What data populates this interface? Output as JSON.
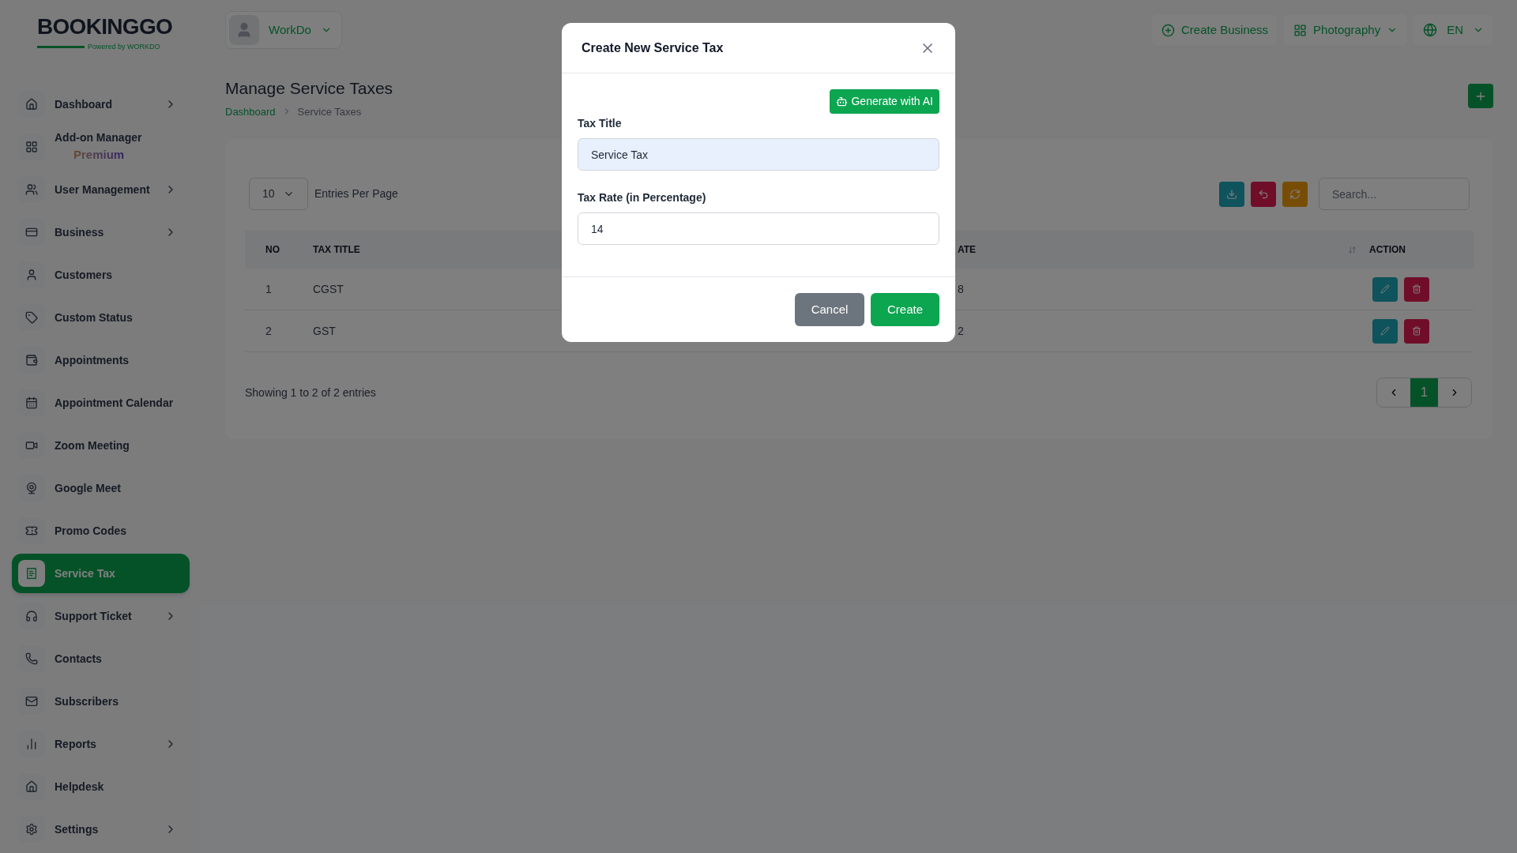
{
  "logo": {
    "name": "BOOKINGGO",
    "tagline": "Powered by WORKDO"
  },
  "sidebar": {
    "items": [
      {
        "label": "Dashboard",
        "submenu": true,
        "selected": false
      },
      {
        "label": "Add-on Manager",
        "badge": "Premium",
        "submenu": false,
        "selected": false
      },
      {
        "label": "User Management",
        "submenu": true,
        "selected": false
      },
      {
        "label": "Business",
        "submenu": true,
        "selected": false
      },
      {
        "label": "Customers",
        "submenu": false,
        "selected": false
      },
      {
        "label": "Custom Status",
        "submenu": false,
        "selected": false
      },
      {
        "label": "Appointments",
        "submenu": false,
        "selected": false
      },
      {
        "label": "Appointment Calendar",
        "submenu": false,
        "selected": false
      },
      {
        "label": "Zoom Meeting",
        "submenu": false,
        "selected": false
      },
      {
        "label": "Google Meet",
        "submenu": false,
        "selected": false
      },
      {
        "label": "Promo Codes",
        "submenu": false,
        "selected": false
      },
      {
        "label": "Service Tax",
        "submenu": false,
        "selected": true
      },
      {
        "label": "Support Ticket",
        "submenu": true,
        "selected": false
      },
      {
        "label": "Contacts",
        "submenu": false,
        "selected": false
      },
      {
        "label": "Subscribers",
        "submenu": false,
        "selected": false
      },
      {
        "label": "Reports",
        "submenu": true,
        "selected": false
      },
      {
        "label": "Helpdesk",
        "submenu": false,
        "selected": false
      },
      {
        "label": "Settings",
        "submenu": true,
        "selected": false
      }
    ]
  },
  "topbar": {
    "user": "WorkDo",
    "create_business": "Create Business",
    "workspace": "Photography",
    "language": "EN"
  },
  "page": {
    "title": "Manage Service Taxes",
    "breadcrumb": [
      "Dashboard",
      "Service Taxes"
    ]
  },
  "table": {
    "per_page": "10",
    "per_page_label": "Entries Per Page",
    "search_placeholder": "Search...",
    "columns": [
      "NO",
      "TAX TITLE",
      "ATE",
      "ACTION"
    ],
    "rows": [
      {
        "no": "1",
        "title": "CGST",
        "rate": "8"
      },
      {
        "no": "2",
        "title": "GST",
        "rate": "2"
      }
    ],
    "summary": "Showing 1 to 2 of 2 entries",
    "pages": [
      {
        "label": "1",
        "selected": true
      }
    ]
  },
  "modal": {
    "title": "Create New Service Tax",
    "ai_button": "Generate with AI",
    "fields": [
      {
        "label": "Tax Title",
        "value": "Service Tax",
        "filled": true
      },
      {
        "label": "Tax Rate (in Percentage)",
        "value": "14",
        "filled": false
      }
    ],
    "buttons": [
      {
        "label": "Cancel",
        "kind": "secondary"
      },
      {
        "label": "Create",
        "kind": "primary"
      }
    ]
  }
}
